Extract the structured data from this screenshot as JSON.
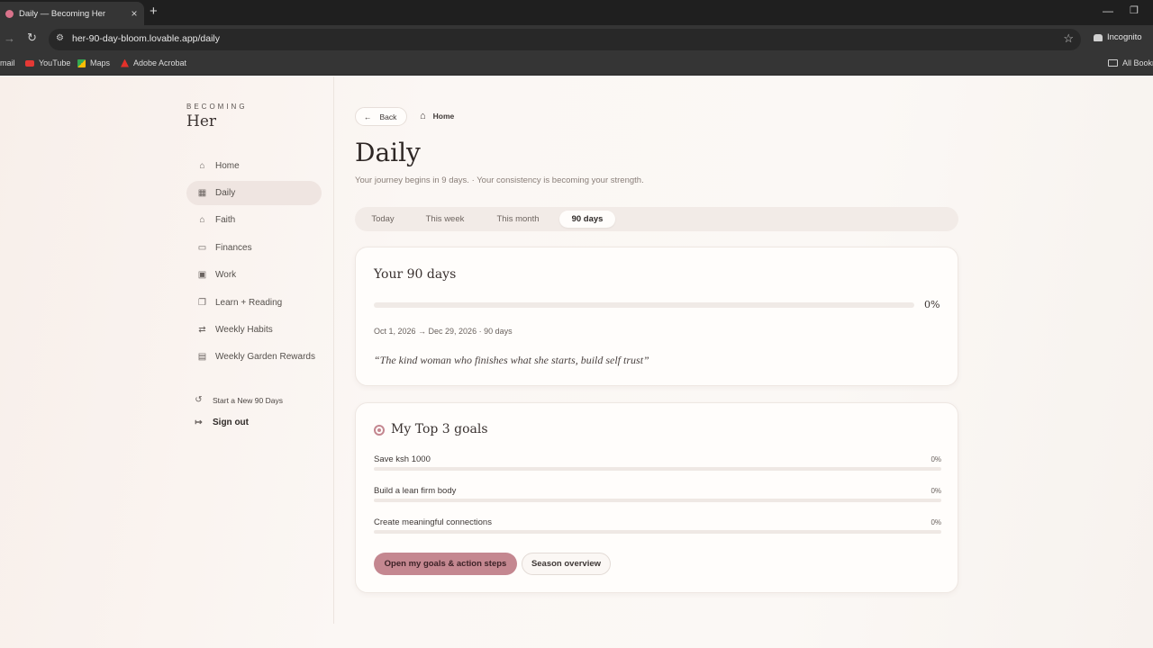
{
  "browser": {
    "tab_title": "Daily — Becoming Her",
    "tab_close": "×",
    "new_tab": "+",
    "url": "her-90-day-bloom.lovable.app/daily",
    "incognito_label": "Incognito",
    "bookmarks": {
      "gmail_partial": "mail",
      "youtube": "YouTube",
      "maps": "Maps",
      "acrobat": "Adobe Acrobat",
      "all_bookmarks": "All Bookm"
    }
  },
  "brand": {
    "small": "BECOMING",
    "big": "Her"
  },
  "sidebar": {
    "items": [
      {
        "label": "Home",
        "icon": "home-icon",
        "glyph": "⌂"
      },
      {
        "label": "Daily",
        "icon": "calendar-icon",
        "glyph": "▦"
      },
      {
        "label": "Faith",
        "icon": "church-icon",
        "glyph": "⌂"
      },
      {
        "label": "Finances",
        "icon": "wallet-icon",
        "glyph": "▭"
      },
      {
        "label": "Work",
        "icon": "briefcase-icon",
        "glyph": "▣"
      },
      {
        "label": "Learn + Reading",
        "icon": "book-icon",
        "glyph": "❐"
      },
      {
        "label": "Weekly Habits",
        "icon": "repeat-icon",
        "glyph": "⇄"
      },
      {
        "label": "Weekly Garden Rewards",
        "icon": "gift-icon",
        "glyph": "▤"
      }
    ],
    "active_item": "Daily",
    "restart_label": "Start a New 90 Days",
    "signout_label": "Sign out"
  },
  "header": {
    "back_label": "Back",
    "home_label": "Home",
    "title": "Daily",
    "subtitle": "Your journey begins in 9 days. · Your consistency is becoming your strength."
  },
  "tabs": [
    {
      "label": "Today",
      "active": false
    },
    {
      "label": "This week",
      "active": false
    },
    {
      "label": "This month",
      "active": false
    },
    {
      "label": "90 days",
      "active": true
    }
  ],
  "overview_card": {
    "title": "Your 90 days",
    "progress_fraction": 0,
    "progress_label": "0%",
    "date_range": "Oct 1, 2026 → Dec 29, 2026 · 90 days",
    "quote": "“The kind woman who finishes what she starts, build self trust”"
  },
  "goals_card": {
    "title": "My Top 3 goals",
    "goals": [
      {
        "label": "Save ksh 1000",
        "pct_label": "0%",
        "progress_fraction": 0
      },
      {
        "label": "Build a lean firm body",
        "pct_label": "0%",
        "progress_fraction": 0
      },
      {
        "label": "Create meaningful connections",
        "pct_label": "0%",
        "progress_fraction": 0
      }
    ],
    "primary_button": "Open my goals & action steps",
    "secondary_button": "Season overview"
  },
  "colors": {
    "accent": "#c48790",
    "background": "#fbf6f3",
    "chrome": "#353535"
  }
}
